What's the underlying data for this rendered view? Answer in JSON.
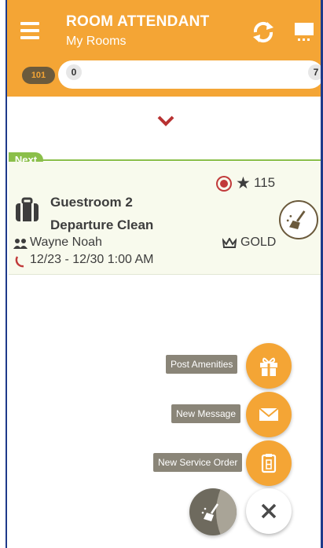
{
  "header": {
    "title": "ROOM ATTENDANT",
    "subtitle": "My Rooms"
  },
  "progress": {
    "room_number": "101",
    "min_label": "0",
    "max_label": "7"
  },
  "queue": {
    "next_label": "Next"
  },
  "card": {
    "points": "115",
    "room_name": "Guestroom 2",
    "task": "Departure Clean",
    "guest_name": "Wayne Noah",
    "tier": "GOLD",
    "dates": "12/23 - 12/30 1:00 AM"
  },
  "actions": {
    "post_amenities": "Post Amenities",
    "new_message": "New Message",
    "new_service_order": "New Service Order"
  },
  "colors": {
    "header_orange": "#f4a535",
    "next_green": "#8bbf4a",
    "dark_brown": "#6b5a3c",
    "status_red": "#c13a3a"
  },
  "icons": {
    "menu": "menu-icon",
    "sync": "sync-icon",
    "screen": "screen-icon",
    "chevron": "chevron-down-icon",
    "luggage": "luggage-icon",
    "clean": "broom-icon",
    "gift": "gift-icon",
    "mail": "envelope-icon",
    "clipboard": "clipboard-icon",
    "close": "close-icon"
  }
}
